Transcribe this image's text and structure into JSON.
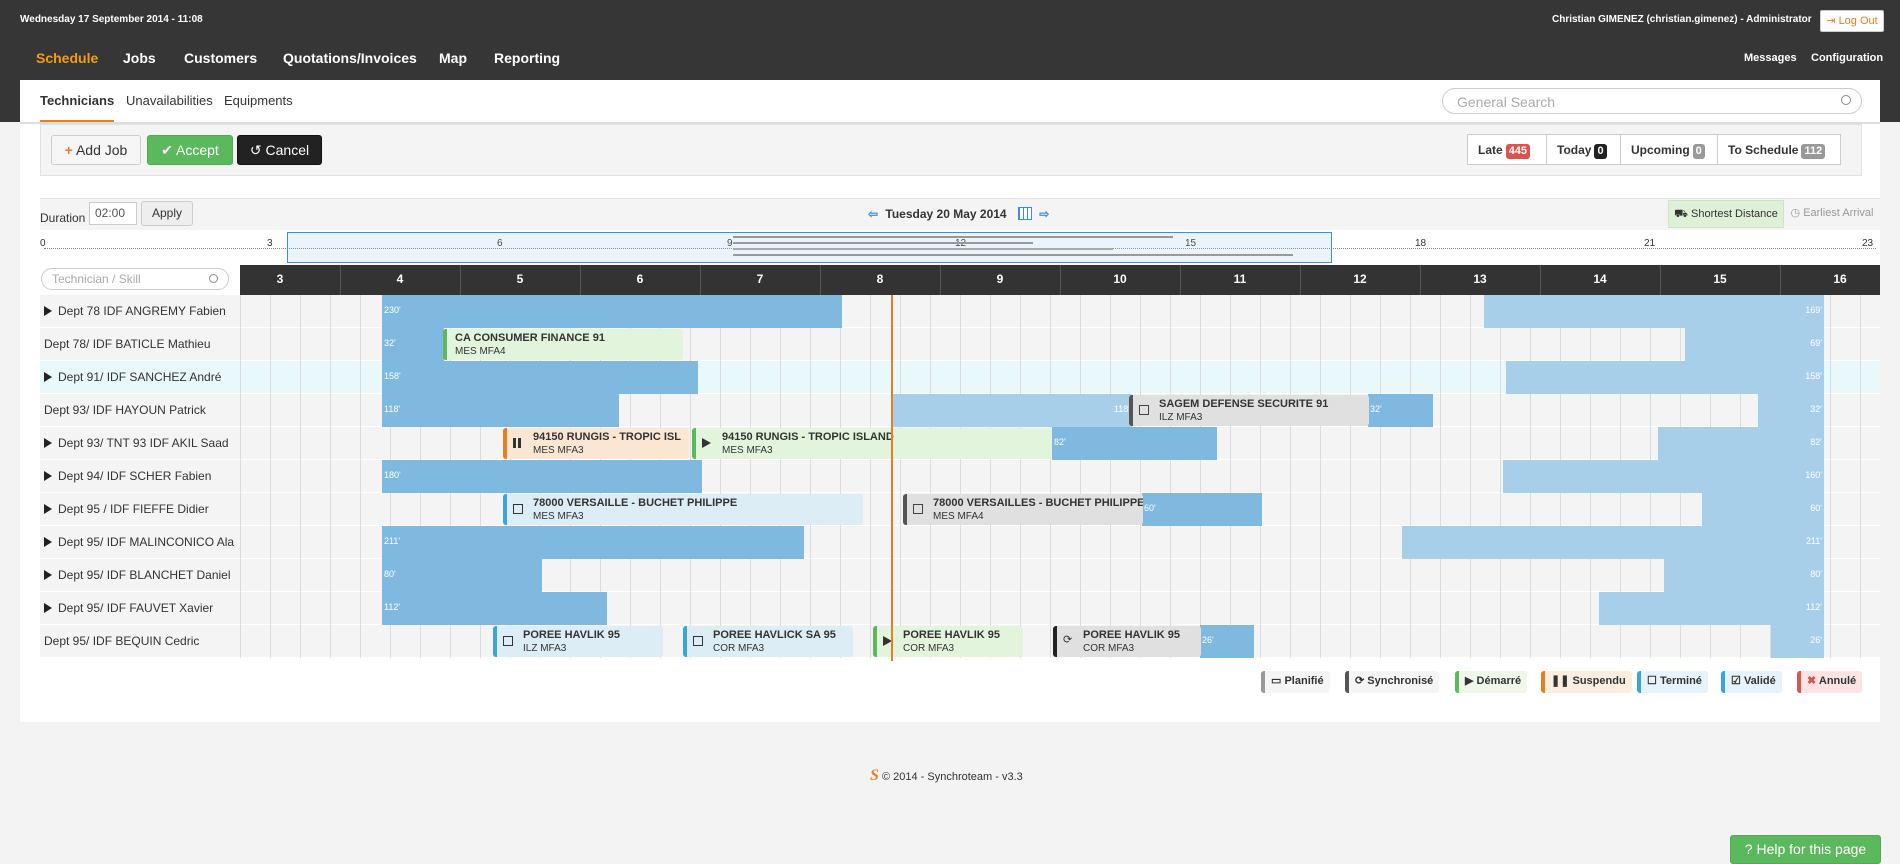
{
  "header": {
    "date": "Wednesday 17 September 2014 - 11:08",
    "user": "Christian GIMENEZ (christian.gimenez) - Administrator",
    "logout": "Log Out"
  },
  "nav": {
    "items": [
      "Schedule",
      "Jobs",
      "Customers",
      "Quotations/Invoices",
      "Map",
      "Reporting"
    ],
    "right": [
      "Messages",
      "Configuration"
    ]
  },
  "subtabs": [
    "Technicians",
    "Unavailabilities",
    "Equipments"
  ],
  "search": {
    "placeholder": "General Search"
  },
  "toolbar": {
    "add": "Add Job",
    "accept": "Accept",
    "cancel": "Cancel"
  },
  "counters": [
    {
      "label": "Late",
      "count": "445"
    },
    {
      "label": "Today",
      "count": "0"
    },
    {
      "label": "Upcoming",
      "count": "0"
    },
    {
      "label": "To Schedule",
      "count": "112"
    }
  ],
  "duration": {
    "label": "Duration",
    "value": "02:00",
    "apply": "Apply"
  },
  "date_nav": {
    "date": "Tuesday 20 May 2014"
  },
  "sort": {
    "shortest": "Shortest Distance",
    "earliest": "Earliest Arrival"
  },
  "ruler": [
    "0",
    "3",
    "6",
    "9",
    "12",
    "15",
    "18",
    "21",
    "23"
  ],
  "tech_search": {
    "placeholder": "Technician / Skill"
  },
  "hours": [
    "3",
    "4",
    "5",
    "6",
    "7",
    "8",
    "9",
    "10",
    "11",
    "12",
    "13",
    "14",
    "15",
    "16"
  ],
  "rows": [
    {
      "name": "Dept 78 IDF ANGREMY Fabien",
      "expand": true,
      "b1": "230'",
      "b2": "169'"
    },
    {
      "name": "Dept 78/ IDF BATICLE Mathieu",
      "expand": false,
      "b1": "32'",
      "b2": "69'"
    },
    {
      "name": "Dept 91/ IDF SANCHEZ André",
      "expand": true,
      "b1": "158'",
      "b2": "158'"
    },
    {
      "name": "Dept 93/ IDF HAYOUN Patrick",
      "expand": false,
      "b1": "118'",
      "b2": "32'",
      "b3": "118'",
      "b4": "32'"
    },
    {
      "name": "Dept 93/ TNT 93 IDF AKIL Saad",
      "expand": true,
      "b1": "82'",
      "b2": "82'"
    },
    {
      "name": "Dept 94/ IDF SCHER Fabien",
      "expand": true,
      "b1": "180'",
      "b2": "160'"
    },
    {
      "name": "Dept 95 / IDF FIEFFE Didier",
      "expand": true,
      "b1": "60'",
      "b2": "60'"
    },
    {
      "name": "Dept 95/ IDF MALINCONICO Ala",
      "expand": true,
      "b1": "211'",
      "b2": "211'"
    },
    {
      "name": "Dept 95/ IDF BLANCHET Daniel",
      "expand": true,
      "b1": "80'",
      "b2": "80'"
    },
    {
      "name": "Dept 95/ IDF FAUVET Xavier",
      "expand": true,
      "b1": "112'",
      "b2": "112'"
    },
    {
      "name": "Dept 95/ IDF BEQUIN Cedric",
      "expand": false,
      "b1": "26'",
      "b2": "26'"
    }
  ],
  "jobs": {
    "j1": {
      "title": "CA CONSUMER FINANCE 91",
      "sub": "MES MFA4"
    },
    "j2": {
      "title": "SAGEM DEFENSE SECURITE 91",
      "sub": "ILZ MFA3"
    },
    "j3": {
      "title": "94150 RUNGIS - TROPIC ISL",
      "sub": "MES MFA3"
    },
    "j4": {
      "title": "94150 RUNGIS - TROPIC ISLAND",
      "sub": "MES MFA3"
    },
    "j5": {
      "title": "78000 VERSAILLE - BUCHET PHILIPPE",
      "sub": "MES MFA3"
    },
    "j6": {
      "title": "78000 VERSAILLES - BUCHET PHILIPPE",
      "sub": "MES MFA4"
    },
    "j7": {
      "title": "POREE HAVLIK 95",
      "sub": "ILZ MFA3"
    },
    "j8": {
      "title": "POREE HAVLICK SA 95",
      "sub": "COR MFA3"
    },
    "j9": {
      "title": "POREE HAVLIK 95",
      "sub": "COR MFA3"
    },
    "j10": {
      "title": "POREE HAVLIK 95",
      "sub": "COR MFA3"
    }
  },
  "legend": [
    "Planifié",
    "Synchronisé",
    "Démarré",
    "Suspendu",
    "Terminé",
    "Validé",
    "Annulé"
  ],
  "footer": "© 2014 - Synchroteam - v3.3",
  "help": "Help for this page",
  "colors": {
    "accent": "#e67e22",
    "busy": "#7fb9e0",
    "accept": "#5cb85c"
  }
}
